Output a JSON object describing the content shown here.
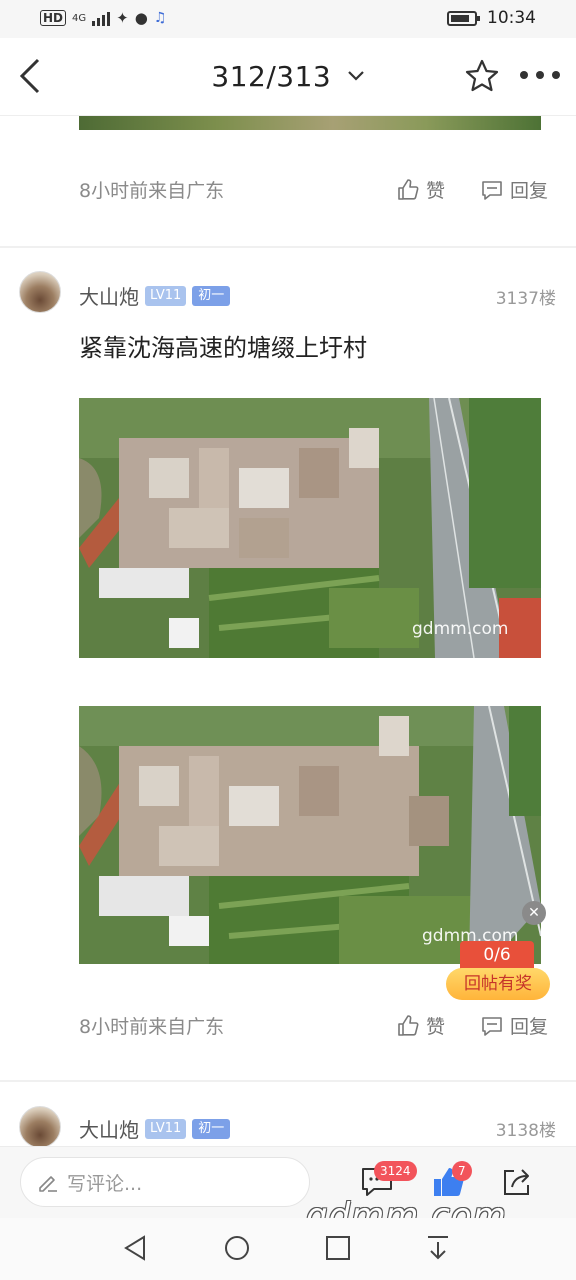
{
  "status_bar": {
    "network": "HD",
    "signal": "4G",
    "time": "10:34"
  },
  "nav": {
    "page_indicator": "312/313",
    "icons": [
      "back-arrow-icon",
      "chevron-down-icon",
      "star-icon",
      "more-icon"
    ]
  },
  "posts": [
    {
      "meta": "8小时前来自广东",
      "like_label": "赞",
      "reply_label": "回复"
    },
    {
      "username": "大山炮",
      "level": "LV11",
      "rank": "初一",
      "floor": "3137楼",
      "text": "紧靠沈海高速的塘缀上圩村",
      "images": [
        {
          "watermark": "gdmm.com"
        },
        {
          "watermark": "gdmm.com"
        }
      ],
      "meta": "8小时前来自广东",
      "like_label": "赞",
      "reply_label": "回复"
    },
    {
      "username": "大山炮",
      "level": "LV11",
      "rank": "初一",
      "floor": "3138楼"
    }
  ],
  "reward_widget": {
    "counter": "0/6",
    "label": "回帖有奖"
  },
  "bottom_bar": {
    "comment_placeholder": "写评论...",
    "comment_count": "3124",
    "like_count": "7"
  },
  "watermark": "gdmm.com",
  "colors": {
    "accent_badge": "#f2545b",
    "level_badge": "#a9c3ee",
    "like_blue": "#3d7ff0"
  }
}
